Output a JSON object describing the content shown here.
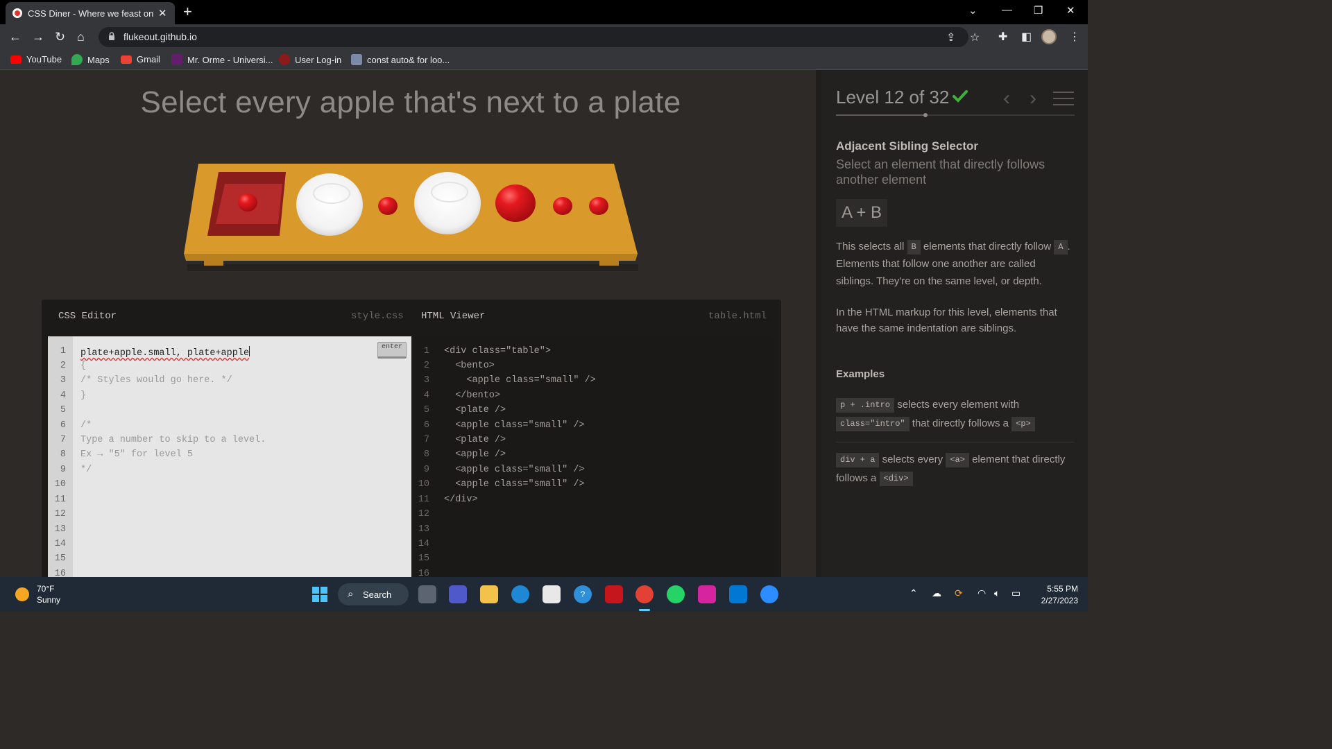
{
  "browser": {
    "tab_title": "CSS Diner - Where we feast on C",
    "url": "flukeout.github.io",
    "bookmarks": [
      "YouTube",
      "Maps",
      "Gmail",
      "Mr. Orme - Universi...",
      "User Log-in",
      "const auto& for loo..."
    ]
  },
  "page": {
    "instruction": "Select every apple that's next to a plate",
    "css_editor": {
      "title": "CSS Editor",
      "filename": "style.css",
      "enter_label": "enter",
      "input_value": "plate+apple.small, plate+apple",
      "lines": [
        "{",
        "/* Styles would go here. */",
        "}",
        "",
        "/*",
        "Type a number to skip to a level.",
        "Ex → \"5\" for level 5",
        "*/"
      ],
      "line_numbers": [
        "1",
        "2",
        "3",
        "4",
        "5",
        "6",
        "7",
        "8",
        "9",
        "10",
        "11",
        "12",
        "13",
        "14",
        "15",
        "16"
      ]
    },
    "html_viewer": {
      "title": "HTML Viewer",
      "filename": "table.html",
      "lines": [
        "<div class=\"table\">",
        "  <bento>",
        "    <apple class=\"small\" />",
        "  </bento>",
        "  <plate />",
        "  <apple class=\"small\" />",
        "  <plate />",
        "  <apple />",
        "  <apple class=\"small\" />",
        "  <apple class=\"small\" />",
        "</div>"
      ],
      "line_numbers": [
        "1",
        "2",
        "3",
        "4",
        "5",
        "6",
        "7",
        "8",
        "9",
        "10",
        "11",
        "12",
        "13",
        "14",
        "15",
        "16"
      ]
    }
  },
  "sidebar": {
    "level_title": "Level 12 of 32",
    "progress": 0.375,
    "selector_name": "Adjacent Sibling Selector",
    "selector_desc": "Select an element that directly follows another element",
    "syntax": "A + B",
    "p1_a": "This selects all",
    "p1_tag_b": "B",
    "p1_b": "elements that directly follow",
    "p1_tag_a": "A",
    "p1_c": ". Elements that follow one another are called siblings. They're on the same level, or depth.",
    "p2": "In the HTML markup for this level, elements that have the same indentation are siblings.",
    "examples_title": "Examples",
    "ex1_code": "p + .intro",
    "ex1_a": "selects every element with",
    "ex1_code2": "class=\"intro\"",
    "ex1_b": "that directly follows a",
    "ex1_code3": "<p>",
    "ex2_code": "div + a",
    "ex2_a": "selects every",
    "ex2_code2": "<a>",
    "ex2_b": "element that directly follows a",
    "ex2_code3": "<div>"
  },
  "taskbar": {
    "temperature": "70°F",
    "condition": "Sunny",
    "search_label": "Search",
    "time": "5:55 PM",
    "date": "2/27/2023"
  },
  "colors": {
    "table": "#d99a2b",
    "apple": "#d8141a",
    "check": "#3fb13f",
    "background": "#2d2a27"
  }
}
